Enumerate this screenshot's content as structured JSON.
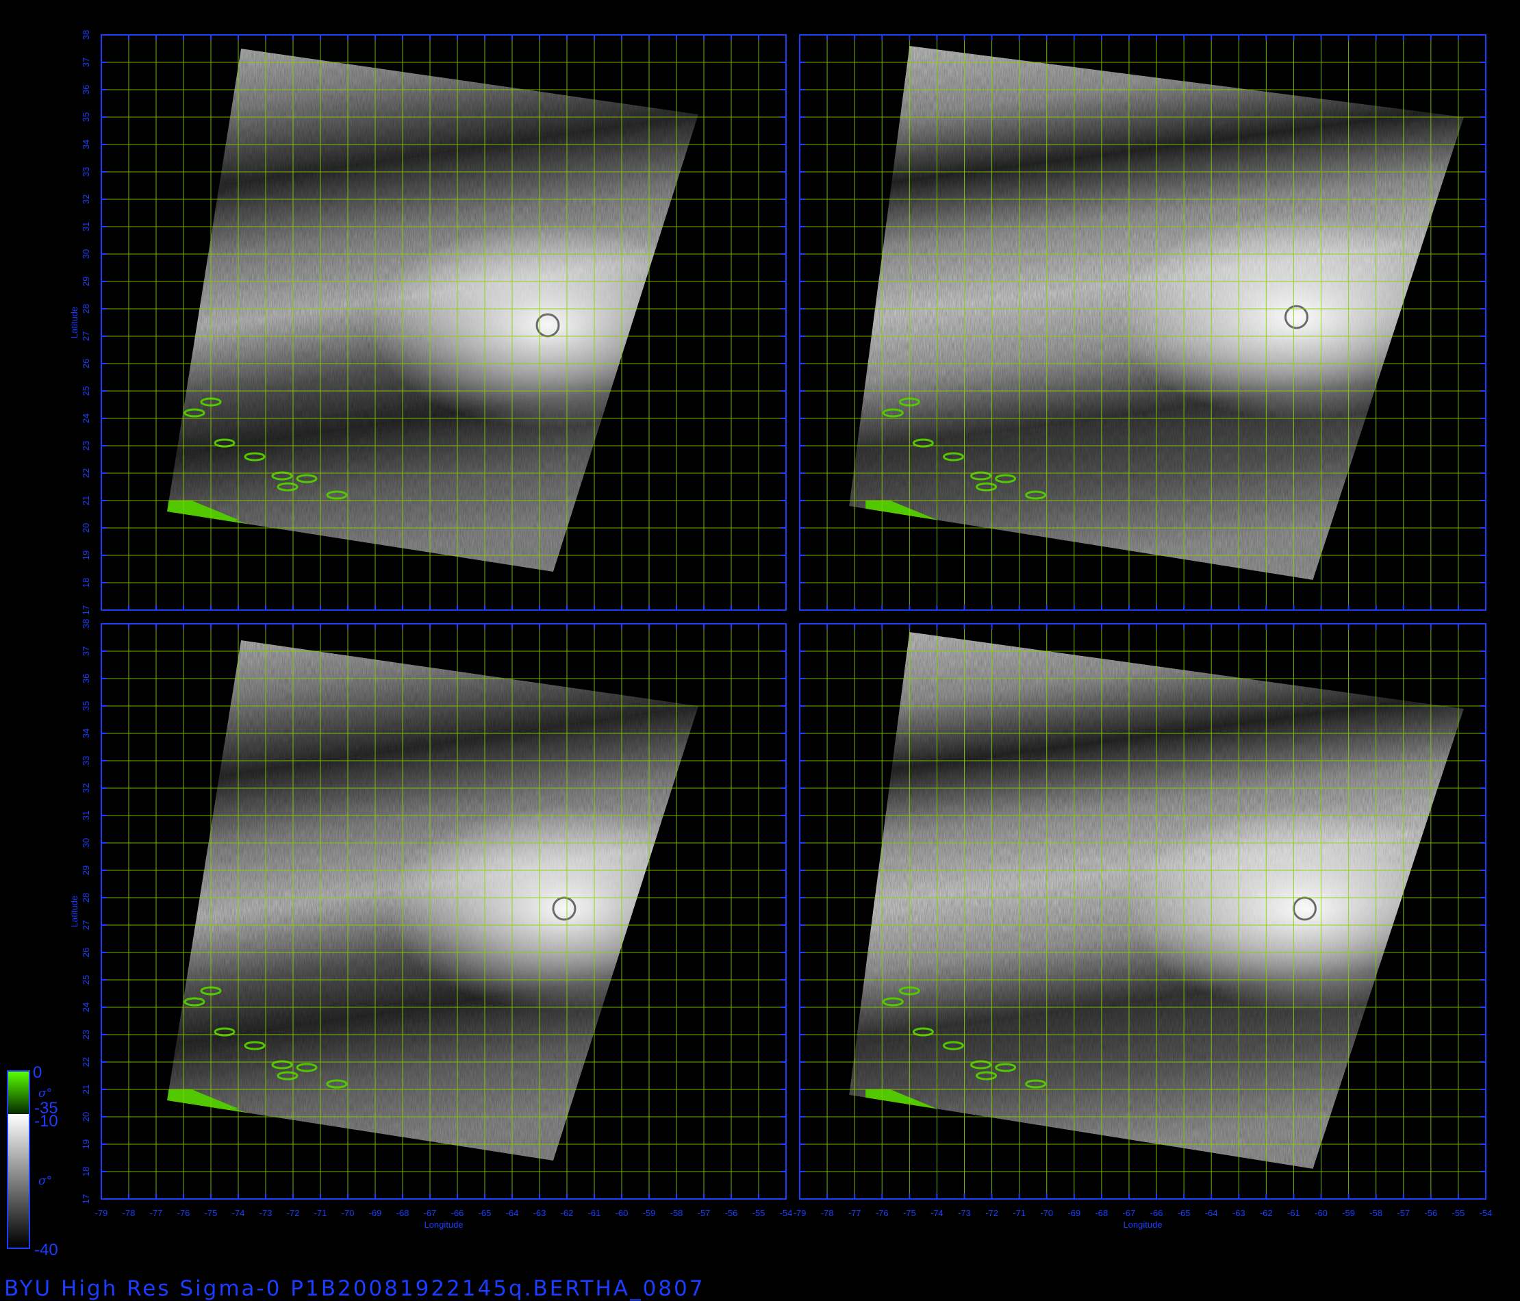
{
  "footer_title": "BYU  High  Res  Sigma-0  P1B20081922145q.BERTHA_0807",
  "colorbar": {
    "land": {
      "top": "0",
      "bottom": "-35",
      "symbol": "σ°",
      "color": "#3fd400"
    },
    "ocean": {
      "top": "-10",
      "bottom": "-40",
      "symbol": "σ°"
    }
  },
  "colors": {
    "frame": "#1a3dff",
    "grid": "#8bd400",
    "land": "#52c800",
    "background": "#000000"
  },
  "chart_data": {
    "type": "map",
    "layout": "2x2 panels",
    "xlabel": "Longitude",
    "ylabel": "Latitude",
    "x_range": [
      -79,
      -54
    ],
    "y_range": [
      17,
      38
    ],
    "x_ticks": [
      "-79",
      "-78",
      "-77",
      "-76",
      "-75",
      "-74",
      "-73",
      "-72",
      "-71",
      "-70",
      "-69",
      "-68",
      "-67",
      "-66",
      "-65",
      "-64",
      "-63",
      "-62",
      "-61",
      "-60",
      "-59",
      "-58",
      "-57",
      "-56",
      "-55",
      "-54"
    ],
    "y_ticks": [
      "17",
      "18",
      "19",
      "20",
      "21",
      "22",
      "23",
      "24",
      "25",
      "26",
      "27",
      "28",
      "29",
      "30",
      "31",
      "32",
      "33",
      "34",
      "35",
      "36",
      "37",
      "38"
    ],
    "grid": true,
    "panels": [
      {
        "id": "top-left",
        "swath_corners": [
          [
            -73.9,
            37.5
          ],
          [
            -57.2,
            35.1
          ],
          [
            -62.5,
            18.4
          ],
          [
            -76.6,
            20.6
          ]
        ],
        "storm_center": [
          -62.7,
          27.4
        ]
      },
      {
        "id": "top-right",
        "swath_corners": [
          [
            -75.0,
            37.6
          ],
          [
            -54.8,
            35.0
          ],
          [
            -60.3,
            18.1
          ],
          [
            -77.2,
            20.8
          ]
        ],
        "storm_center": [
          -60.9,
          27.7
        ]
      },
      {
        "id": "bottom-left",
        "swath_corners": [
          [
            -73.9,
            37.4
          ],
          [
            -57.2,
            35.0
          ],
          [
            -62.5,
            18.4
          ],
          [
            -76.6,
            20.6
          ]
        ],
        "storm_center": [
          -62.1,
          27.6
        ]
      },
      {
        "id": "bottom-right",
        "swath_corners": [
          [
            -75.0,
            37.7
          ],
          [
            -54.8,
            34.9
          ],
          [
            -60.3,
            18.1
          ],
          [
            -77.2,
            20.8
          ]
        ],
        "storm_center": [
          -60.6,
          27.6
        ]
      }
    ]
  }
}
